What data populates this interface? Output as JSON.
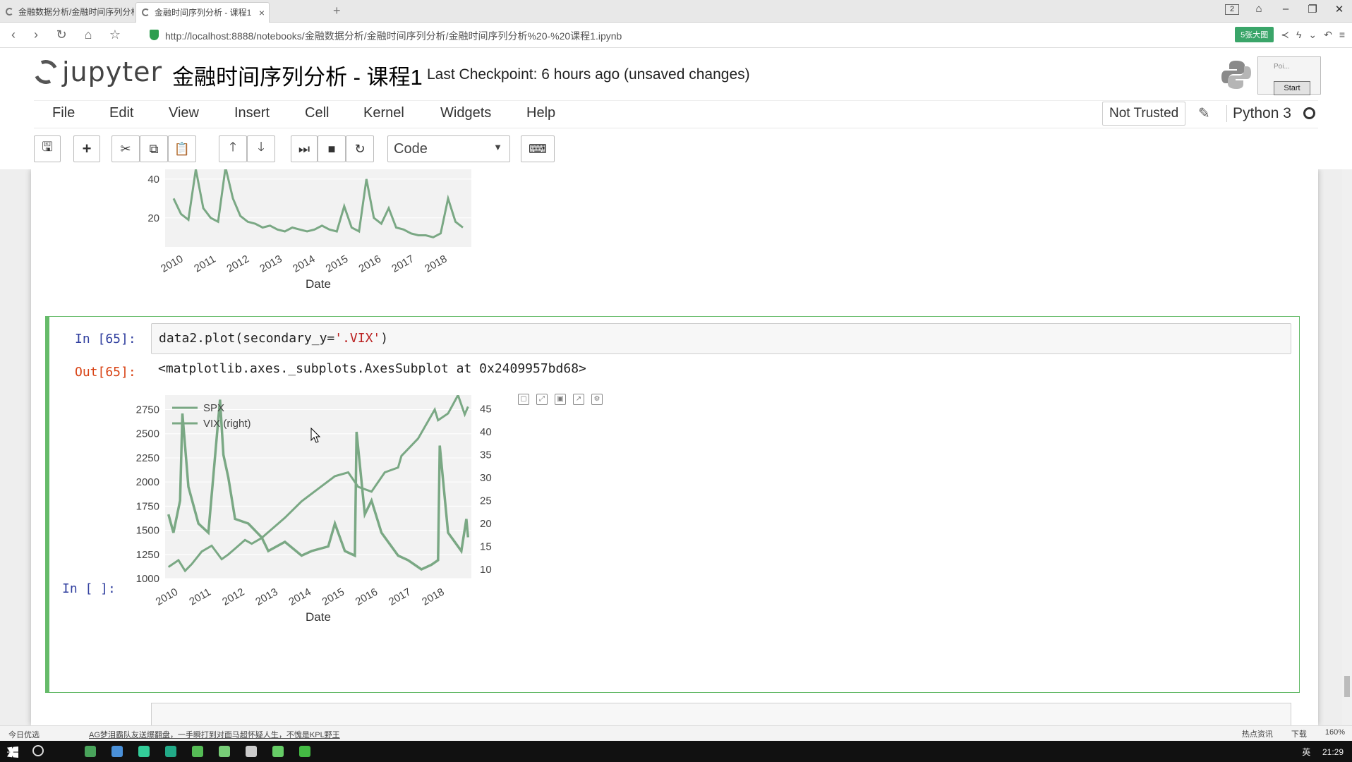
{
  "browser": {
    "tabs": [
      {
        "title": "金融数据分析/金融时间序列分析",
        "active": false
      },
      {
        "title": "金融时间序列分析 - 课程1",
        "active": true
      }
    ],
    "tab_count": "2",
    "url": "http://localhost:8888/notebooks/金融数据分析/金融时间序列分析/金融时间序列分析%20-%20课程1.ipynb",
    "big_img_label": "5张大图"
  },
  "jupyter": {
    "logo_text": "jupyter",
    "notebook_title": "金融时间序列分析 - 课程1",
    "checkpoint": "Last Checkpoint: 6 hours ago (unsaved changes)",
    "overlay": {
      "poi_text": "Poi...",
      "start_label": "Start"
    },
    "menu": [
      "File",
      "Edit",
      "View",
      "Insert",
      "Cell",
      "Kernel",
      "Widgets",
      "Help"
    ],
    "trust_label": "Not Trusted",
    "kernel_name": "Python 3",
    "cell_type": "Code"
  },
  "cells": {
    "in_prompt": "In  [65]:",
    "code_prefix": "data2.plot(secondary_y=",
    "code_str": "'.VIX'",
    "code_suffix": ")",
    "out_prompt": "Out[65]:",
    "out_text": "<matplotlib.axes._subplots.AxesSubplot at 0x2409957bd68>",
    "empty_prompt": "In  [ ]:"
  },
  "chart_data": [
    {
      "type": "line",
      "title": "",
      "xlabel": "Date",
      "ylabel": "",
      "x_ticks": [
        "2010",
        "2011",
        "2012",
        "2013",
        "2014",
        "2015",
        "2016",
        "2017",
        "2018"
      ],
      "y_ticks": [
        20,
        40
      ],
      "series": [
        {
          "values": [
            30,
            22,
            19,
            45,
            25,
            20,
            18,
            46,
            30,
            21,
            18,
            17,
            15,
            16,
            14,
            13,
            15,
            14,
            13,
            14,
            16,
            14,
            13,
            26,
            15,
            13,
            40,
            20,
            17,
            25,
            15,
            14,
            12,
            11,
            11,
            10,
            12,
            30,
            18,
            15
          ]
        }
      ],
      "color": "#7aa884"
    },
    {
      "type": "line",
      "title": "",
      "xlabel": "Date",
      "x_ticks": [
        "2010",
        "2011",
        "2012",
        "2013",
        "2014",
        "2015",
        "2016",
        "2017",
        "2018"
      ],
      "y_ticks_left": [
        1000,
        1250,
        1500,
        1750,
        2000,
        2250,
        2500,
        2750
      ],
      "y_ticks_right": [
        10,
        15,
        20,
        25,
        30,
        35,
        40,
        45
      ],
      "ylim_left": [
        1000,
        2900
      ],
      "ylim_right": [
        8,
        48
      ],
      "legend_position": "upper-left",
      "series": [
        {
          "name": "SPX",
          "axis": "left",
          "x": [
            2010.0,
            2010.3,
            2010.5,
            2010.7,
            2011.0,
            2011.3,
            2011.6,
            2011.8,
            2012.0,
            2012.3,
            2012.5,
            2012.8,
            2013.0,
            2013.5,
            2014.0,
            2014.5,
            2015.0,
            2015.4,
            2015.7,
            2016.1,
            2016.5,
            2016.9,
            2017.0,
            2017.5,
            2018.0,
            2018.1,
            2018.4,
            2018.7,
            2018.9,
            2019.0
          ],
          "values": [
            1120,
            1190,
            1080,
            1150,
            1280,
            1340,
            1200,
            1250,
            1310,
            1400,
            1360,
            1420,
            1480,
            1630,
            1800,
            1930,
            2060,
            2100,
            1950,
            1900,
            2100,
            2150,
            2270,
            2450,
            2750,
            2640,
            2710,
            2900,
            2700,
            2780
          ]
        },
        {
          "name": "VIX (right)",
          "axis": "right",
          "x": [
            2010.0,
            2010.15,
            2010.35,
            2010.42,
            2010.6,
            2010.9,
            2011.2,
            2011.55,
            2011.65,
            2011.8,
            2012.0,
            2012.4,
            2012.8,
            2013.0,
            2013.5,
            2014.0,
            2014.3,
            2014.8,
            2015.0,
            2015.3,
            2015.6,
            2015.65,
            2015.9,
            2016.1,
            2016.4,
            2016.9,
            2017.2,
            2017.6,
            2017.9,
            2018.1,
            2018.15,
            2018.4,
            2018.8,
            2018.95,
            2019.0
          ],
          "values": [
            22,
            18,
            25,
            44,
            28,
            20,
            18,
            47,
            35,
            30,
            21,
            20,
            17,
            14,
            16,
            13,
            14,
            15,
            20,
            14,
            13,
            40,
            22,
            25,
            18,
            13,
            12,
            10,
            11,
            12,
            37,
            18,
            14,
            21,
            17
          ]
        }
      ],
      "color": "#7aa884"
    }
  ],
  "statusbar": {
    "left": "今日优选",
    "news": "AG梦泪霸队友送爆翻盘，一手瞬打到对面马超怀疑人生，不愧是KPL野王",
    "right_items": [
      "热点资讯",
      "下载",
      "160%"
    ]
  },
  "taskbar": {
    "time": "21:29",
    "lang": "英"
  }
}
